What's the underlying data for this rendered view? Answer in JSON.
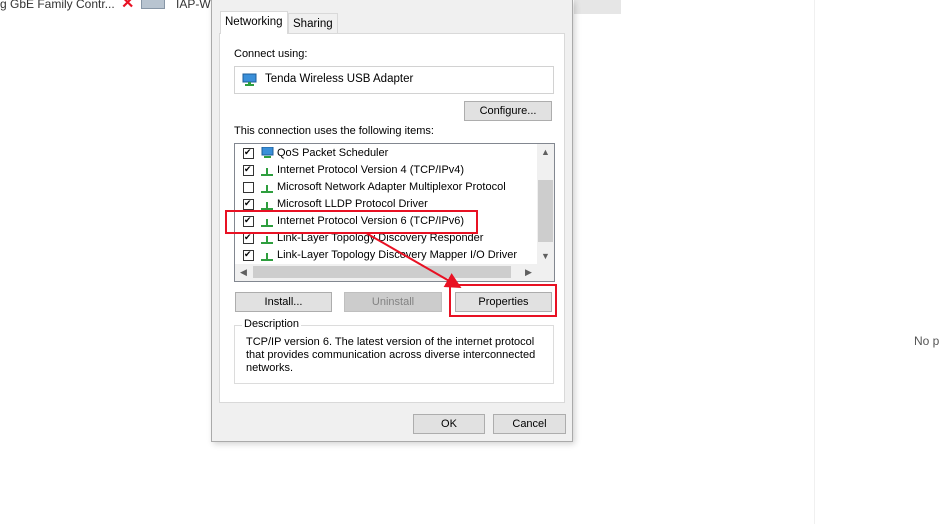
{
  "background": {
    "explorer_item_1": "g GbE Family Contr...",
    "explorer_item_2": "IAP-Wi",
    "right_pane_text": "No p"
  },
  "dialog": {
    "tabs": [
      {
        "label": "Networking",
        "active": true
      },
      {
        "label": "Sharing",
        "active": false
      }
    ],
    "connect_using_label": "Connect using:",
    "adapter_name": "Tenda Wireless USB Adapter",
    "configure_label": "Configure...",
    "items_label": "This connection uses the following items:",
    "items": [
      {
        "label": "QoS Packet Scheduler",
        "checked": true,
        "icon": "qos-scheduler-icon"
      },
      {
        "label": "Internet Protocol Version 4 (TCP/IPv4)",
        "checked": true,
        "icon": "network-protocol-icon"
      },
      {
        "label": "Microsoft Network Adapter Multiplexor Protocol",
        "checked": false,
        "icon": "network-protocol-icon"
      },
      {
        "label": "Microsoft LLDP Protocol Driver",
        "checked": true,
        "icon": "network-protocol-icon"
      },
      {
        "label": "Internet Protocol Version 6 (TCP/IPv6)",
        "checked": true,
        "icon": "network-protocol-icon"
      },
      {
        "label": "Link-Layer Topology Discovery Responder",
        "checked": true,
        "icon": "network-protocol-icon"
      },
      {
        "label": "Link-Layer Topology Discovery Mapper I/O Driver",
        "checked": true,
        "icon": "network-protocol-icon"
      }
    ],
    "install_label": "Install...",
    "uninstall_label": "Uninstall",
    "properties_label": "Properties",
    "description_title": "Description",
    "description_text": "TCP/IP version 6. The latest version of the internet protocol that provides communication across diverse interconnected networks.",
    "ok_label": "OK",
    "cancel_label": "Cancel"
  },
  "colors": {
    "highlight": "#e81123",
    "protocol_icon": "#2e9e3e"
  }
}
